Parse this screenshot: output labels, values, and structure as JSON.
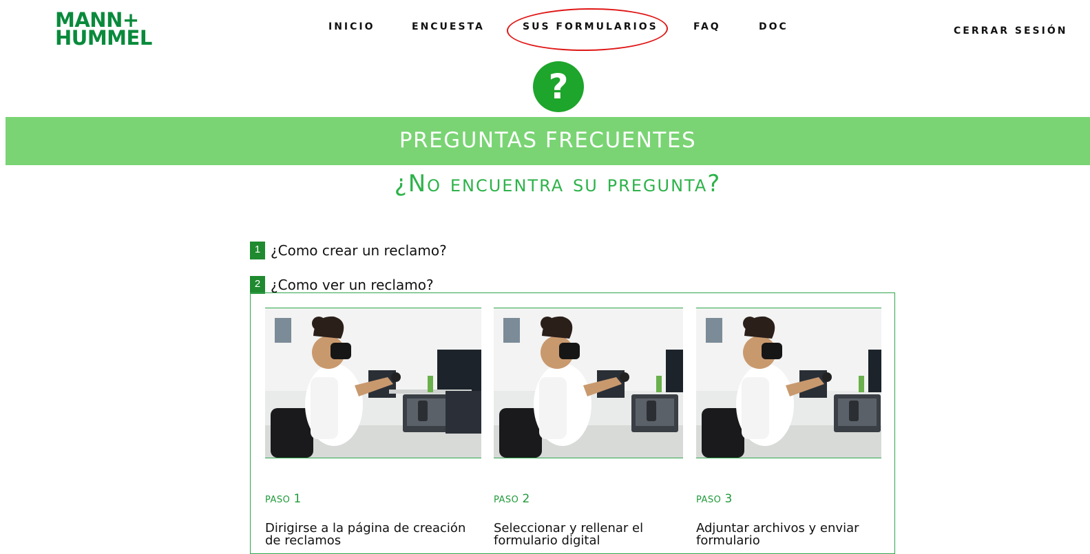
{
  "header": {
    "logo": {
      "line1": "MANN",
      "plus": "+",
      "line2": "HUMMEL"
    },
    "nav": [
      {
        "label": "INICIO"
      },
      {
        "label": "ENCUESTA"
      },
      {
        "label": "SUS FORMULARIOS"
      },
      {
        "label": "FAQ"
      },
      {
        "label": "DOC"
      }
    ],
    "logout_label": "CERRAR SESIÓN"
  },
  "hero": {
    "icon_glyph": "?",
    "banner_title": "PREGUNTAS FRECUENTES",
    "subtitle": "¿No encuentra su pregunta?"
  },
  "faq": {
    "items": [
      {
        "number": "1",
        "question": "¿Como crear un reclamo?"
      },
      {
        "number": "2",
        "question": "¿Como ver un reclamo?"
      }
    ],
    "steps": [
      {
        "label_small": "PASO",
        "label_num": "1",
        "description": "Dirigirse a la página de creación de reclamos"
      },
      {
        "label_small": "PASO",
        "label_num": "2",
        "description": "Seleccionar y rellenar el formulario digital"
      },
      {
        "label_small": "PASO",
        "label_num": "3",
        "description": "Adjuntar archivos y enviar formulario"
      }
    ]
  },
  "colors": {
    "brand_green": "#0a8a3c",
    "banner_green": "#7ad474",
    "icon_green": "#1ea52b",
    "annotation_red": "#e01515"
  }
}
